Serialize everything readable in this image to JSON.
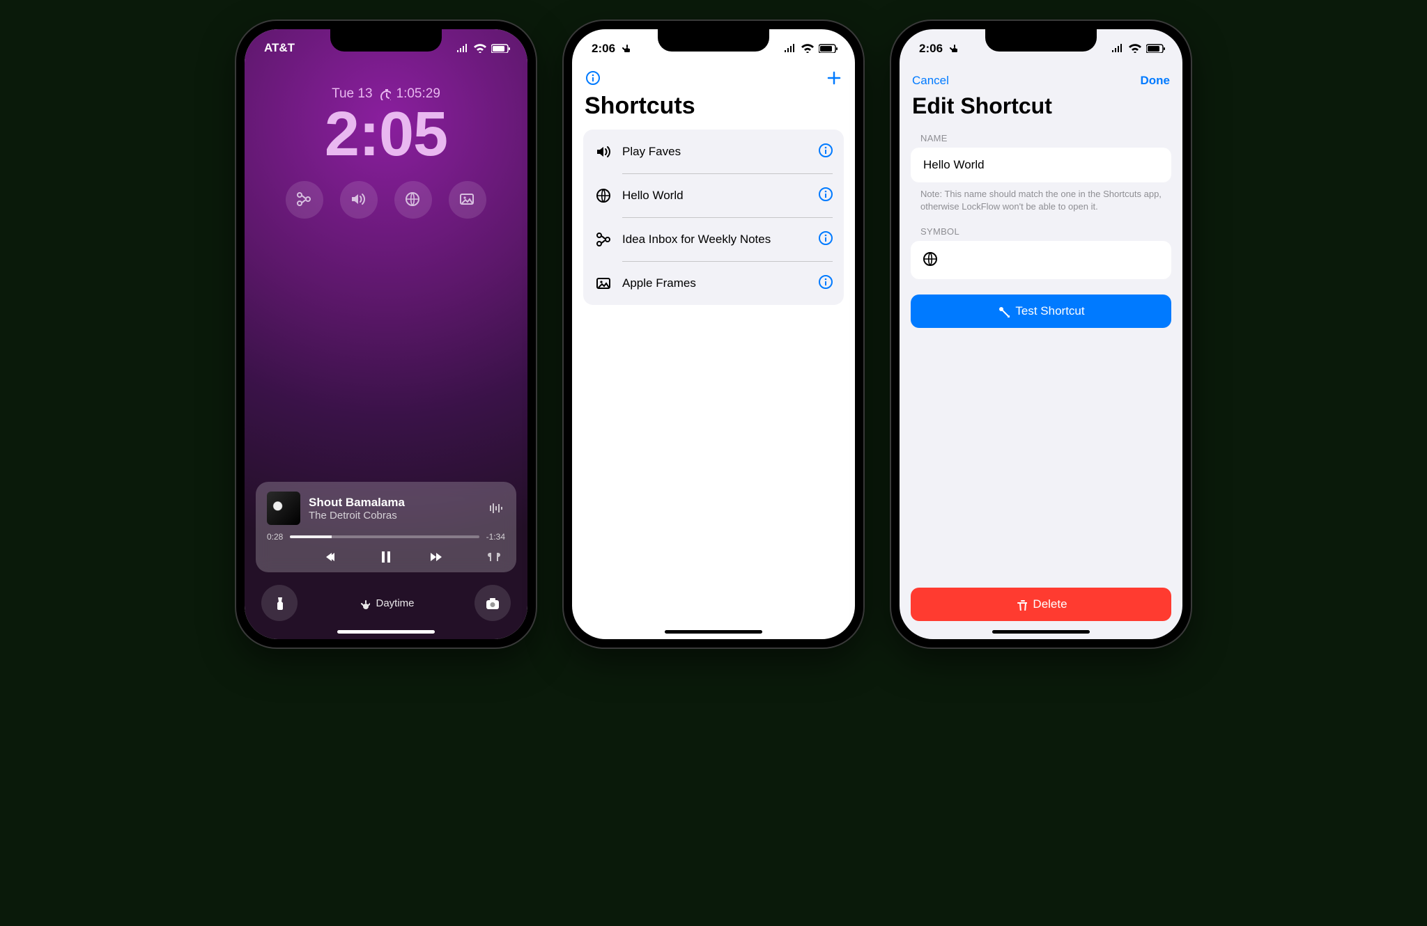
{
  "lockscreen": {
    "carrier": "AT&T",
    "date_label": "Tue 13",
    "timer_label": "1:05:29",
    "clock": "2:05",
    "widgets": [
      "shortcut-icon",
      "speaker-icon",
      "globe-icon",
      "image-icon"
    ],
    "nowplaying": {
      "title": "Shout Bamalama",
      "artist": "The Detroit Cobras",
      "elapsed": "0:28",
      "remaining": "-1:34"
    },
    "focus_label": "Daytime"
  },
  "shortcuts": {
    "time": "2:06",
    "title": "Shortcuts",
    "items": [
      {
        "label": "Play Faves",
        "icon": "speaker-icon"
      },
      {
        "label": "Hello World",
        "icon": "globe-icon"
      },
      {
        "label": "Idea Inbox for Weekly Notes",
        "icon": "shortcut-merge-icon"
      },
      {
        "label": "Apple Frames",
        "icon": "image-icon"
      }
    ]
  },
  "edit": {
    "time": "2:06",
    "cancel": "Cancel",
    "done": "Done",
    "title": "Edit Shortcut",
    "name_header": "NAME",
    "name_value": "Hello World",
    "note": "Note: This name should match the one in the Shortcuts app, otherwise LockFlow won't be able to open it.",
    "symbol_header": "SYMBOL",
    "test_label": "Test Shortcut",
    "delete_label": "Delete"
  }
}
